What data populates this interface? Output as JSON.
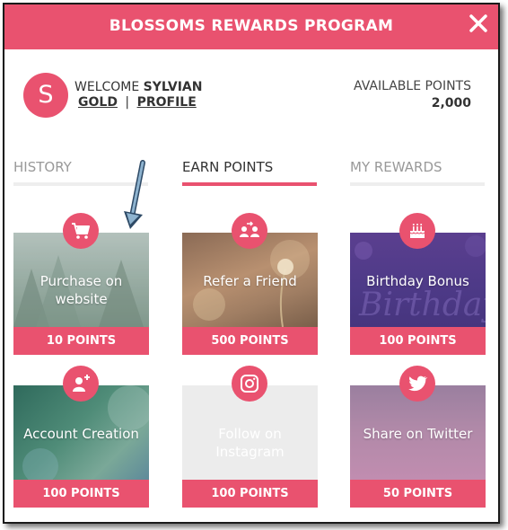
{
  "header": {
    "title": "BLOSSOMS REWARDS PROGRAM",
    "close_icon": "close-icon"
  },
  "user": {
    "avatar_letter": "S",
    "welcome_prefix": "WELCOME",
    "name": "SYLVIAN",
    "tier_link": "GOLD",
    "separator": "|",
    "profile_link": "PROFILE"
  },
  "points": {
    "label": "AVAILABLE POINTS",
    "value": "2,000"
  },
  "tabs": [
    {
      "label": "HISTORY",
      "active": false
    },
    {
      "label": "EARN POINTS",
      "active": true
    },
    {
      "label": "MY REWARDS",
      "active": false
    }
  ],
  "tiles": [
    {
      "label_line1": "Purchase on",
      "label_line2": "website",
      "points": "10 POINTS",
      "icon": "shopping-cart-icon"
    },
    {
      "label_line1": "Refer a Friend",
      "label_line2": "",
      "points": "500 POINTS",
      "icon": "refer-friend-icon"
    },
    {
      "label_line1": "Birthday Bonus",
      "label_line2": "",
      "points": "100 POINTS",
      "icon": "birthday-cake-icon"
    },
    {
      "label_line1": "Account Creation",
      "label_line2": "",
      "points": "100 POINTS",
      "icon": "add-user-icon"
    },
    {
      "label_line1": "Follow on",
      "label_line2": "Instagram",
      "points": "100 POINTS",
      "icon": "instagram-icon"
    },
    {
      "label_line1": "Share on Twitter",
      "label_line2": "",
      "points": "50 POINTS",
      "icon": "twitter-icon"
    }
  ],
  "colors": {
    "accent": "#e9526f",
    "tab_inactive_text": "#999999"
  }
}
